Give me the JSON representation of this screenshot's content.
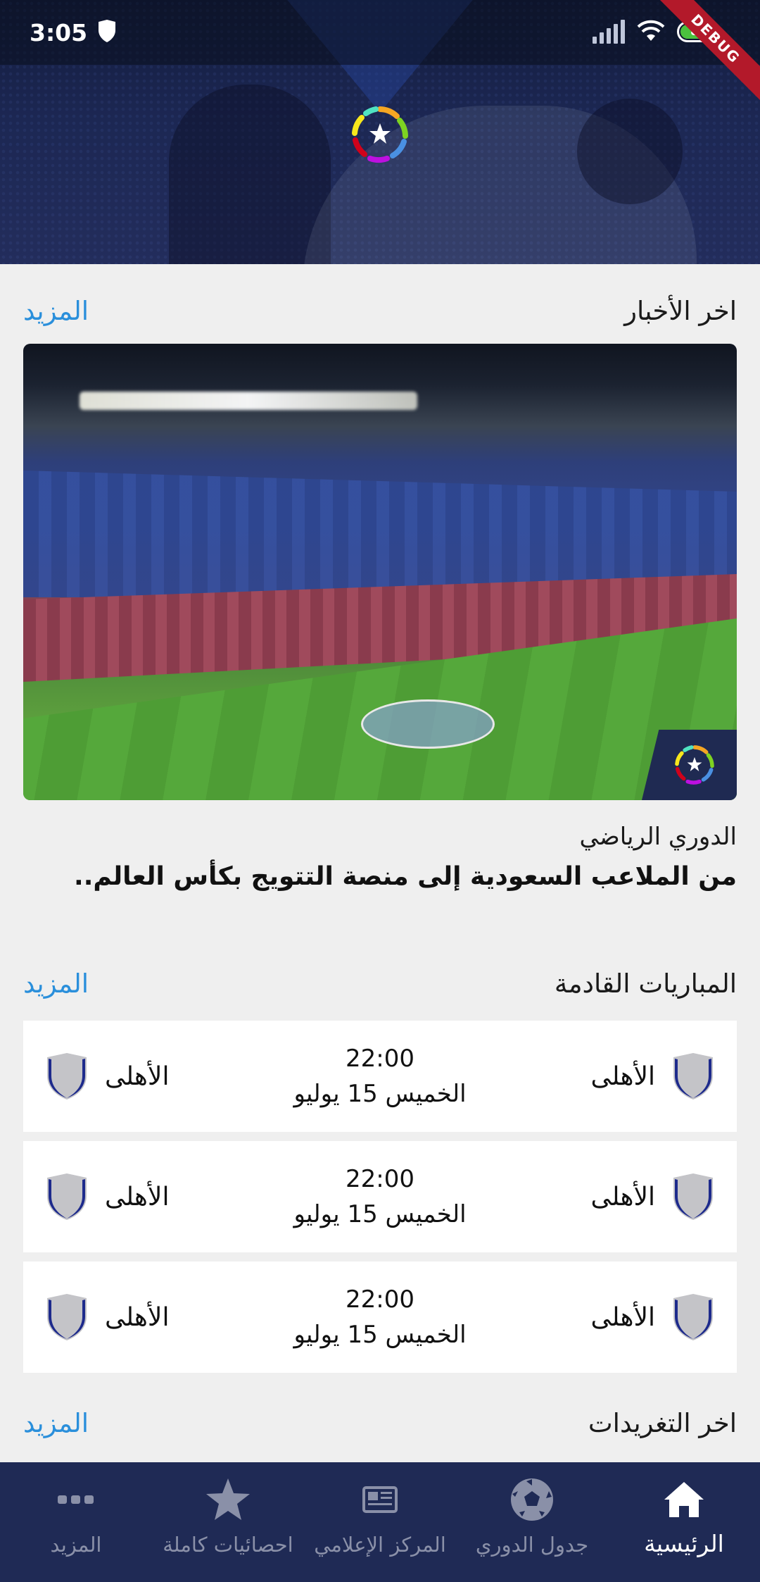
{
  "status_bar": {
    "time": "3:05",
    "battery": "86"
  },
  "debug_ribbon": "DEBUG",
  "news": {
    "section_title": "اخر الأخبار",
    "more_label": "المزيد",
    "source": "الدوري الرياضي",
    "headline": "من الملاعب السعودية إلى منصة التتويج بكأس العالم.."
  },
  "matches": {
    "section_title": "المباريات القادمة",
    "more_label": "المزيد",
    "items": [
      {
        "home": "الأهلى",
        "away": "الأهلى",
        "time": "22:00",
        "date": "الخميس 15 يوليو"
      },
      {
        "home": "الأهلى",
        "away": "الأهلى",
        "time": "22:00",
        "date": "الخميس 15 يوليو"
      },
      {
        "home": "الأهلى",
        "away": "الأهلى",
        "time": "22:00",
        "date": "الخميس 15 يوليو"
      }
    ]
  },
  "tweets": {
    "section_title": "اخر التغريدات",
    "more_label": "المزيد"
  },
  "bottom_nav": {
    "items": [
      {
        "label": "الرئيسية",
        "icon": "home-icon",
        "active": true
      },
      {
        "label": "جدول الدوري",
        "icon": "soccer-ball-icon",
        "active": false
      },
      {
        "label": "المركز الإعلامي",
        "icon": "newspaper-icon",
        "active": false
      },
      {
        "label": "احصائيات كاملة",
        "icon": "star-icon",
        "active": false
      },
      {
        "label": "المزيد",
        "icon": "more-dots-icon",
        "active": false
      }
    ]
  },
  "colors": {
    "header_bg": "#1c2753",
    "accent_link": "#2a8fdb",
    "nav_bg": "#1f2a55",
    "nav_inactive": "#8a90a8",
    "shield_fill": "#c4c4c8",
    "shield_stroke": "#1d2a8c"
  }
}
